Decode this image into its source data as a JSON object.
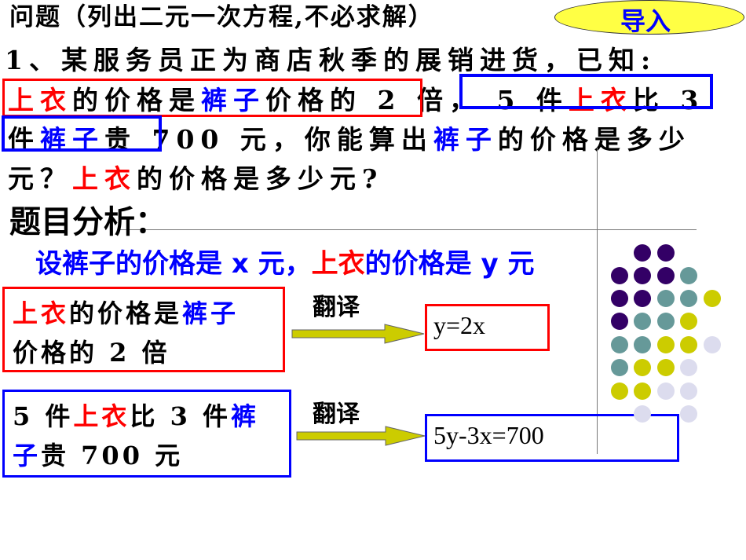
{
  "header": {
    "title": "问题（列出二元一次方程,不必求解）",
    "badge": "导入"
  },
  "problem": {
    "line1": "1、某服务员正为商店秋季的展销进货，已知:",
    "line2": [
      "上衣",
      "的价格是",
      "裤子",
      "价格的 2 倍，",
      "5 件",
      "上衣",
      "比 3"
    ],
    "line3": [
      "件",
      "裤子",
      "贵 700 元，你能算出",
      "裤子",
      "的价格是多少"
    ],
    "line4": [
      "元？",
      "上衣",
      "的价格是多少元?"
    ]
  },
  "analysis": {
    "heading": "题目分析：",
    "assumption": [
      "设裤子的价格是 x 元，",
      "上衣",
      "的价格是 y 元"
    ]
  },
  "box1": {
    "line1": [
      "上衣",
      "的价格是",
      "裤子"
    ],
    "line2": "价格的 2 倍"
  },
  "box2": {
    "line1": [
      "5 件",
      "上衣",
      "比 3 件",
      "裤"
    ],
    "line2": [
      "子",
      "贵 700 元"
    ]
  },
  "translate_label": "翻译",
  "equations": {
    "eq1": "y=2x",
    "eq2": "5y-3x=700"
  },
  "colors": {
    "red": "#ff0000",
    "blue": "#0000ff",
    "arrow": "#cccc00",
    "purple": "#330066",
    "teal": "#669999",
    "yellow": "#cccc00",
    "lavender": "#dcdcee"
  }
}
